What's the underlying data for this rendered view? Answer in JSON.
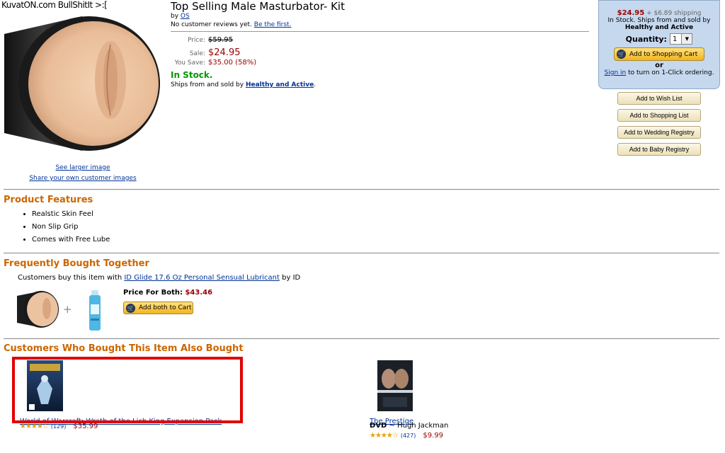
{
  "watermark": "KuvatON.com BullShitIt >:[",
  "product": {
    "title": "Top Selling Male Masturbator- Kit",
    "by_prefix": "by",
    "brand": "OS",
    "reviews_text": "No customer reviews yet.",
    "be_first": "Be the first.",
    "price_label": "Price:",
    "list_price": "$59.95",
    "sale_label": "Sale:",
    "sale_price": "$24.95",
    "save_label": "You Save:",
    "save_value": "$35.00 (58%)",
    "stock": "In Stock.",
    "ships_prefix": "Ships from and sold by",
    "seller": "Healthy and Active",
    "see_larger": "See larger image",
    "share_images": "Share your own customer images"
  },
  "buybox": {
    "price": "$24.95",
    "shipping": "+ $6.89 shipping",
    "stock_line": "In Stock. Ships from and sold by",
    "seller": "Healthy and Active",
    "qty_label": "Quantity:",
    "qty_value": "1",
    "add_cart": "Add to Shopping Cart",
    "or": "or",
    "sign_in": "Sign in",
    "one_click": "to turn on 1-Click ordering."
  },
  "side_buttons": [
    "Add to Wish List",
    "Add to Shopping List",
    "Add to Wedding Registry",
    "Add to Baby Registry"
  ],
  "features": {
    "title": "Product Features",
    "items": [
      "Realstic Skin Feel",
      "Non Slip Grip",
      "Comes with Free Lube"
    ]
  },
  "fbt": {
    "title": "Frequently Bought Together",
    "prefix": "Customers buy this item with",
    "item_link": "ID Glide 17.6 Oz Personal Sensual Lubricant",
    "suffix": "by ID",
    "price_label": "Price For Both:",
    "price": "$43.46",
    "add_both": "Add both to Cart"
  },
  "also_bought": {
    "title": "Customers Who Bought This Item Also Bought",
    "items": [
      {
        "title": "World of Warcraft: Wrath of the Lich King Expansion Pack",
        "format": "",
        "artist": "",
        "stars": "★★★★☆",
        "count": "(129)",
        "price": "$35.99"
      },
      {
        "title": "The Prestige",
        "format": "DVD",
        "artist": "~ Hugh Jackman",
        "stars": "★★★★☆",
        "count": "(427)",
        "price": "$9.99"
      }
    ]
  },
  "colors": {
    "section_title": "#cc6600",
    "price_red": "#990000",
    "in_stock": "#009900",
    "link": "#003399",
    "highlight_box": "#e00000"
  }
}
